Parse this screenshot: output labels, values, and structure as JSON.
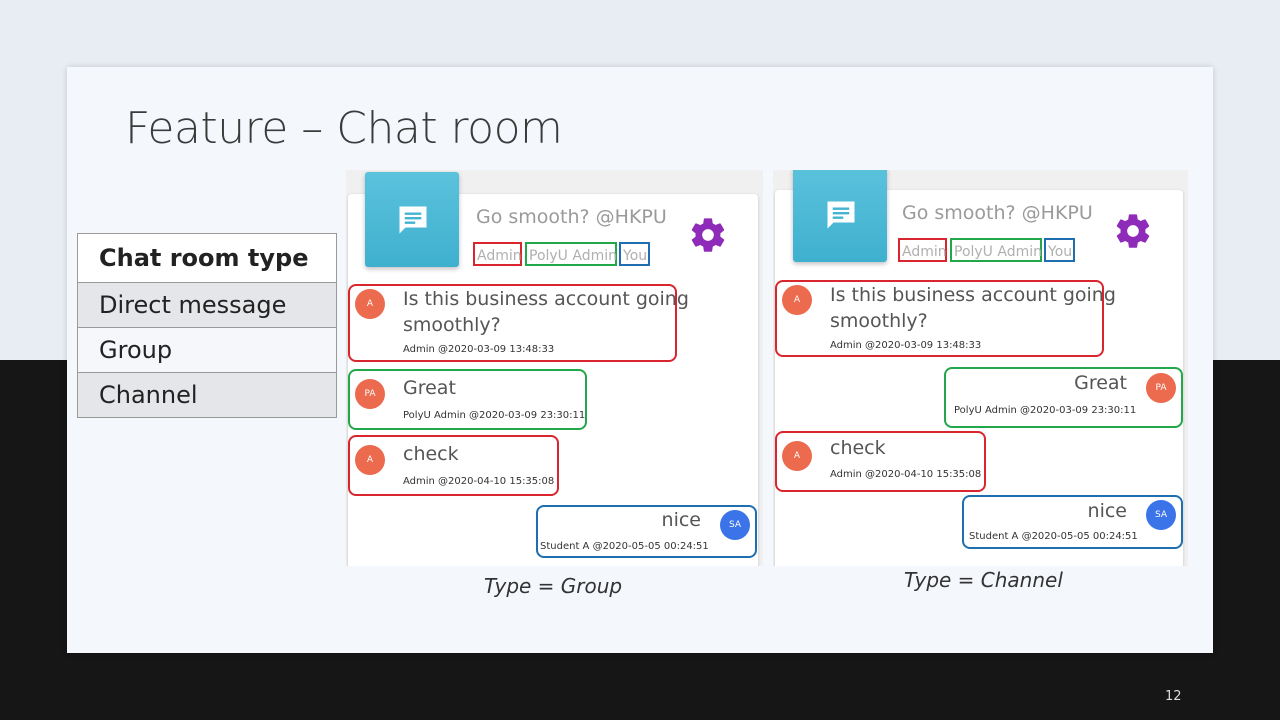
{
  "slide": {
    "title": "Feature – Chat room",
    "page_number": "12"
  },
  "types_table": {
    "header": "Chat room type",
    "rows": [
      "Direct message",
      "Group",
      "Channel"
    ]
  },
  "screens": [
    {
      "caption": "Type = Group",
      "room_title": "Go smooth? @HKPU",
      "tags": [
        "Admin",
        "PolyU Admin",
        "You"
      ],
      "messages": [
        {
          "avatar": "A",
          "text": "Is this business account going smoothly?",
          "line1": "Is this business account going",
          "line2": "smoothly?",
          "meta": "Admin @2020-03-09 13:48:33"
        },
        {
          "avatar": "PA",
          "text": "Great",
          "meta": "PolyU Admin @2020-03-09 23:30:11"
        },
        {
          "avatar": "A",
          "text": "check",
          "meta": "Admin @2020-04-10 15:35:08"
        },
        {
          "avatar": "SA",
          "text": "nice",
          "meta": "Student A @2020-05-05 00:24:51"
        }
      ]
    },
    {
      "caption": "Type = Channel",
      "room_title": "Go smooth? @HKPU",
      "tags": [
        "Admin",
        "PolyU Admin",
        "You"
      ],
      "messages": [
        {
          "avatar": "A",
          "text": "Is this business account going smoothly?",
          "line1": "Is this business account going",
          "line2": "smoothly?",
          "meta": "Admin @2020-03-09 13:48:33"
        },
        {
          "avatar": "PA",
          "text": "Great",
          "meta": "PolyU Admin @2020-03-09 23:30:11"
        },
        {
          "avatar": "A",
          "text": "check",
          "meta": "Admin @2020-04-10 15:35:08"
        },
        {
          "avatar": "SA",
          "text": "nice",
          "meta": "Student A @2020-05-05 00:24:51"
        }
      ]
    }
  ],
  "colors": {
    "red_box": "#d9262e",
    "green_box": "#22a84a",
    "blue_box": "#1f6fb0",
    "chat_icon": "#45b4d2",
    "gear_icon": "#8e2bb8",
    "avatar_orange": "#ec6a4e",
    "avatar_blue": "#3b73e8"
  },
  "icons": {
    "chat_room": "chat-bubble-icon",
    "settings": "gear-icon"
  }
}
